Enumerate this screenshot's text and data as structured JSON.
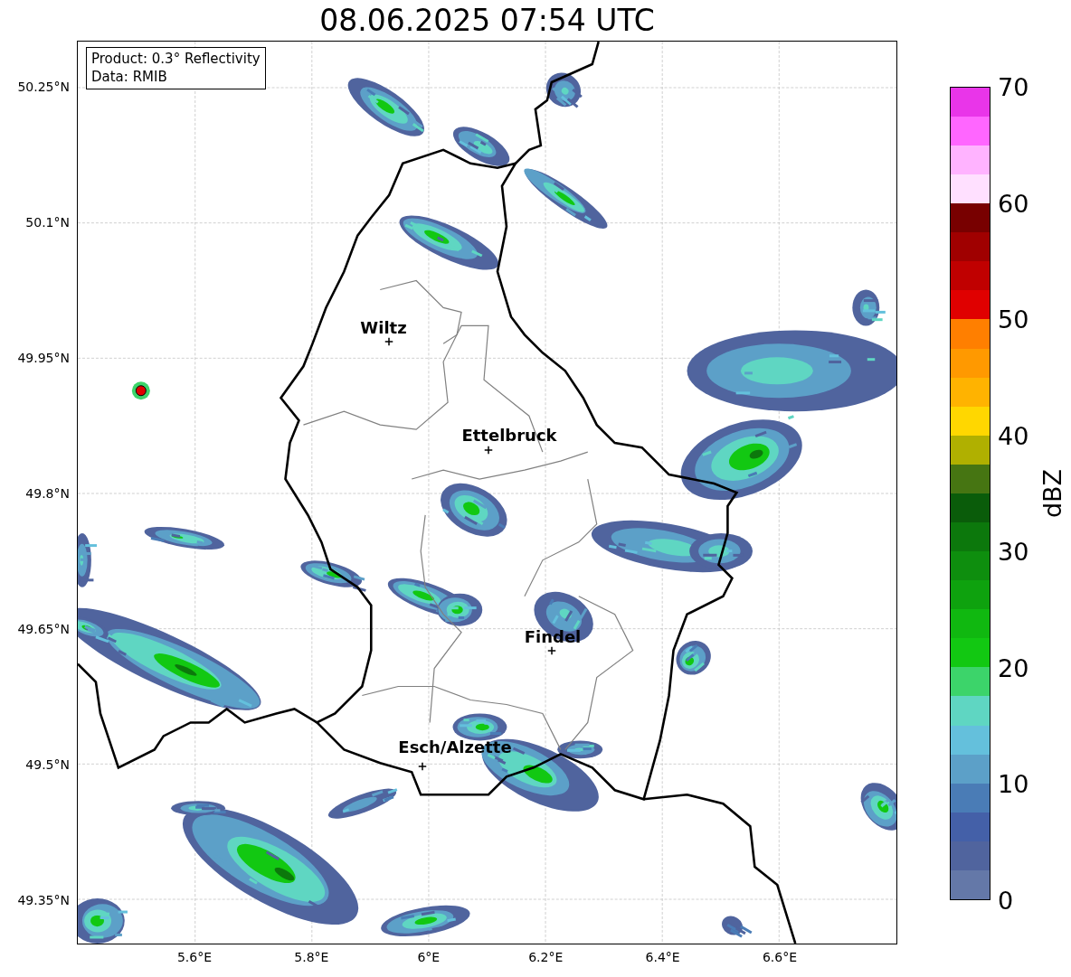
{
  "title": "08.06.2025 07:54 UTC",
  "legend": [
    "Product: 0.3° Reflectivity",
    "Data: RMIB"
  ],
  "map": {
    "kind": "map",
    "xticks": [
      "5.6°E",
      "5.8°E",
      "6°E",
      "6.2°E",
      "6.4°E",
      "6.6°E"
    ],
    "yticks": [
      "50.25°N",
      "50.1°N",
      "49.95°N",
      "49.8°N",
      "49.65°N",
      "49.5°N",
      "49.35°N"
    ],
    "cities": [
      {
        "name": "Wiltz"
      },
      {
        "name": "Ettelbruck"
      },
      {
        "name": "Findel"
      },
      {
        "name": "Esch/Alzette"
      }
    ]
  },
  "colorbar": {
    "label": "dBZ",
    "ticks": [
      "70",
      "60",
      "50",
      "40",
      "30",
      "20",
      "10",
      "0"
    ],
    "segments": [
      {
        "color": "#6478a8"
      },
      {
        "color": "#50649e"
      },
      {
        "color": "#4460a8"
      },
      {
        "color": "#4a7cb6"
      },
      {
        "color": "#5ca0c8"
      },
      {
        "color": "#64c0dc"
      },
      {
        "color": "#5fd6c2"
      },
      {
        "color": "#3cd46a"
      },
      {
        "color": "#12c812"
      },
      {
        "color": "#10b810"
      },
      {
        "color": "#0ea20e"
      },
      {
        "color": "#0e8e0e"
      },
      {
        "color": "#0c780c"
      },
      {
        "color": "#0a5c0a"
      },
      {
        "color": "#467512"
      },
      {
        "color": "#b0b000"
      },
      {
        "color": "#ffd700"
      },
      {
        "color": "#ffb300"
      },
      {
        "color": "#ff9900"
      },
      {
        "color": "#ff7f00"
      },
      {
        "color": "#e00000"
      },
      {
        "color": "#c00000"
      },
      {
        "color": "#a00000"
      },
      {
        "color": "#780000"
      },
      {
        "color": "#ffe0ff"
      },
      {
        "color": "#ffb3ff"
      },
      {
        "color": "#ff66ff"
      },
      {
        "color": "#e935e9"
      }
    ]
  }
}
